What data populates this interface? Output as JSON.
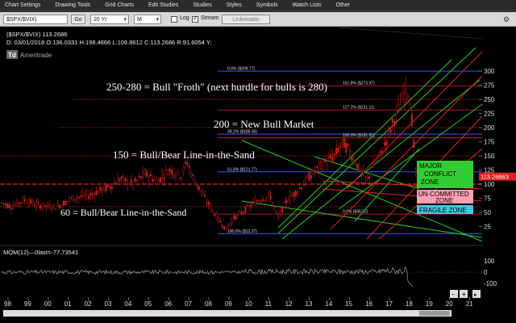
{
  "menu": [
    {
      "label": "Chart Settings",
      "key": "C"
    },
    {
      "label": "Drawing Tools",
      "key": "D"
    },
    {
      "label": "Grid Charts",
      "key": "G"
    },
    {
      "label": "Edit Studies",
      "key": "E"
    },
    {
      "label": "Studies",
      "key": "S"
    },
    {
      "label": "Styles",
      "key": "t"
    },
    {
      "label": "Symbols",
      "key": "y"
    },
    {
      "label": "Watch Lists",
      "key": "W"
    },
    {
      "label": "Other",
      "key": "O"
    }
  ],
  "toolbar": {
    "symbol": "$SPX/$VIX)",
    "go": "Go",
    "range": "20 Yr",
    "interval": "M",
    "log_label": "Log",
    "log_checked": false,
    "stream_label": "Stream",
    "stream_checked": true,
    "link": "Linkomatic"
  },
  "header": {
    "symbol_line": "($SPX/$VIX)  113.2686",
    "ohlc_line": "D: 03/01/2018  O:136.0331  H:198.4666  L:106.8612  C:113.2686  R:91.6054  Y:",
    "brand": "Ameritrade"
  },
  "annotations": [
    {
      "text": "250-280 = Bull \"Froth\" (next hurdle for bulls is 280)",
      "value": 250
    },
    {
      "text": "200 = New Bull Market",
      "value": 200
    },
    {
      "text": "150 = Bull/Bear Line-in-the-Sand",
      "value": 150
    },
    {
      "text": "60 = Bull/Bear Line-in-the-Sand",
      "value": 60
    }
  ],
  "fib_labels": [
    {
      "text": "0.0% ($299.77)",
      "value": 299.77
    },
    {
      "text": "161.8% ($273.97)",
      "value": 273.97
    },
    {
      "text": "127.2% ($231.11)",
      "value": 231.11
    },
    {
      "text": "38.2% ($188.36)",
      "value": 188.36
    },
    {
      "text": "100.0% ($181.91)",
      "value": 181.91
    },
    {
      "text": "61.8% ($121.77)",
      "value": 121.77
    },
    {
      "text": "0.0% ($46.92)",
      "value": 46.92
    },
    {
      "text": "100.0% ($12.37)",
      "value": 12.37
    }
  ],
  "zones": {
    "major": {
      "line1": "MAJOR",
      "line2": "CONFLICT",
      "line3": "ZONE",
      "color": "#33cc33"
    },
    "uncommitted": {
      "line1": "UN-COMMITTED",
      "line2": "ZONE",
      "color": "#ff9fb0"
    },
    "fragile": {
      "line1": "FRAGILE ZONE",
      "color": "#3fc9e0"
    }
  },
  "price_tag": "113.26863",
  "price_axis": {
    "ticks": [
      300,
      275,
      250,
      225,
      200,
      175,
      150,
      125,
      100,
      75,
      50,
      25
    ]
  },
  "x_axis": {
    "labels": [
      "98",
      "99",
      "00",
      "01",
      "02",
      "03",
      "04",
      "05",
      "06",
      "07",
      "08",
      "09",
      "10",
      "11",
      "12",
      "13",
      "14",
      "15",
      "16",
      "17",
      "18",
      "19",
      "20",
      "21"
    ]
  },
  "momentum": {
    "label": "MOM(12)—0last=-77.73541",
    "ticks": [
      "100",
      "0",
      "-100"
    ]
  },
  "colors": {
    "blue": "#3355ff",
    "red": "#e02020",
    "green": "#22cc22",
    "candle": "#c81e1e"
  },
  "chart_data": {
    "type": "candlestick",
    "series": [
      {
        "name": "($SPX/$VIX)",
        "last": 113.2686
      }
    ],
    "ylim": [
      0,
      310
    ],
    "yticks": [
      300,
      275,
      250,
      225,
      200,
      175,
      150,
      125,
      100,
      75,
      50,
      25
    ],
    "xtick_labels": [
      "98",
      "99",
      "00",
      "01",
      "02",
      "03",
      "04",
      "05",
      "06",
      "07",
      "08",
      "09",
      "10",
      "11",
      "12",
      "13",
      "14",
      "15",
      "16",
      "17",
      "18",
      "19",
      "20",
      "21"
    ],
    "key_levels": [
      250,
      200,
      150,
      60
    ],
    "fib_levels": [
      299.77,
      273.97,
      231.11,
      188.36,
      181.91,
      121.77,
      46.92,
      12.37
    ],
    "last_ohlc": {
      "date": "03/01/2018",
      "open": 136.0331,
      "high": 198.4666,
      "low": 106.8612,
      "close": 113.2686
    },
    "momentum": {
      "period": 12,
      "last": -77.73541,
      "ylim": [
        -100,
        100
      ]
    },
    "grid": false
  }
}
